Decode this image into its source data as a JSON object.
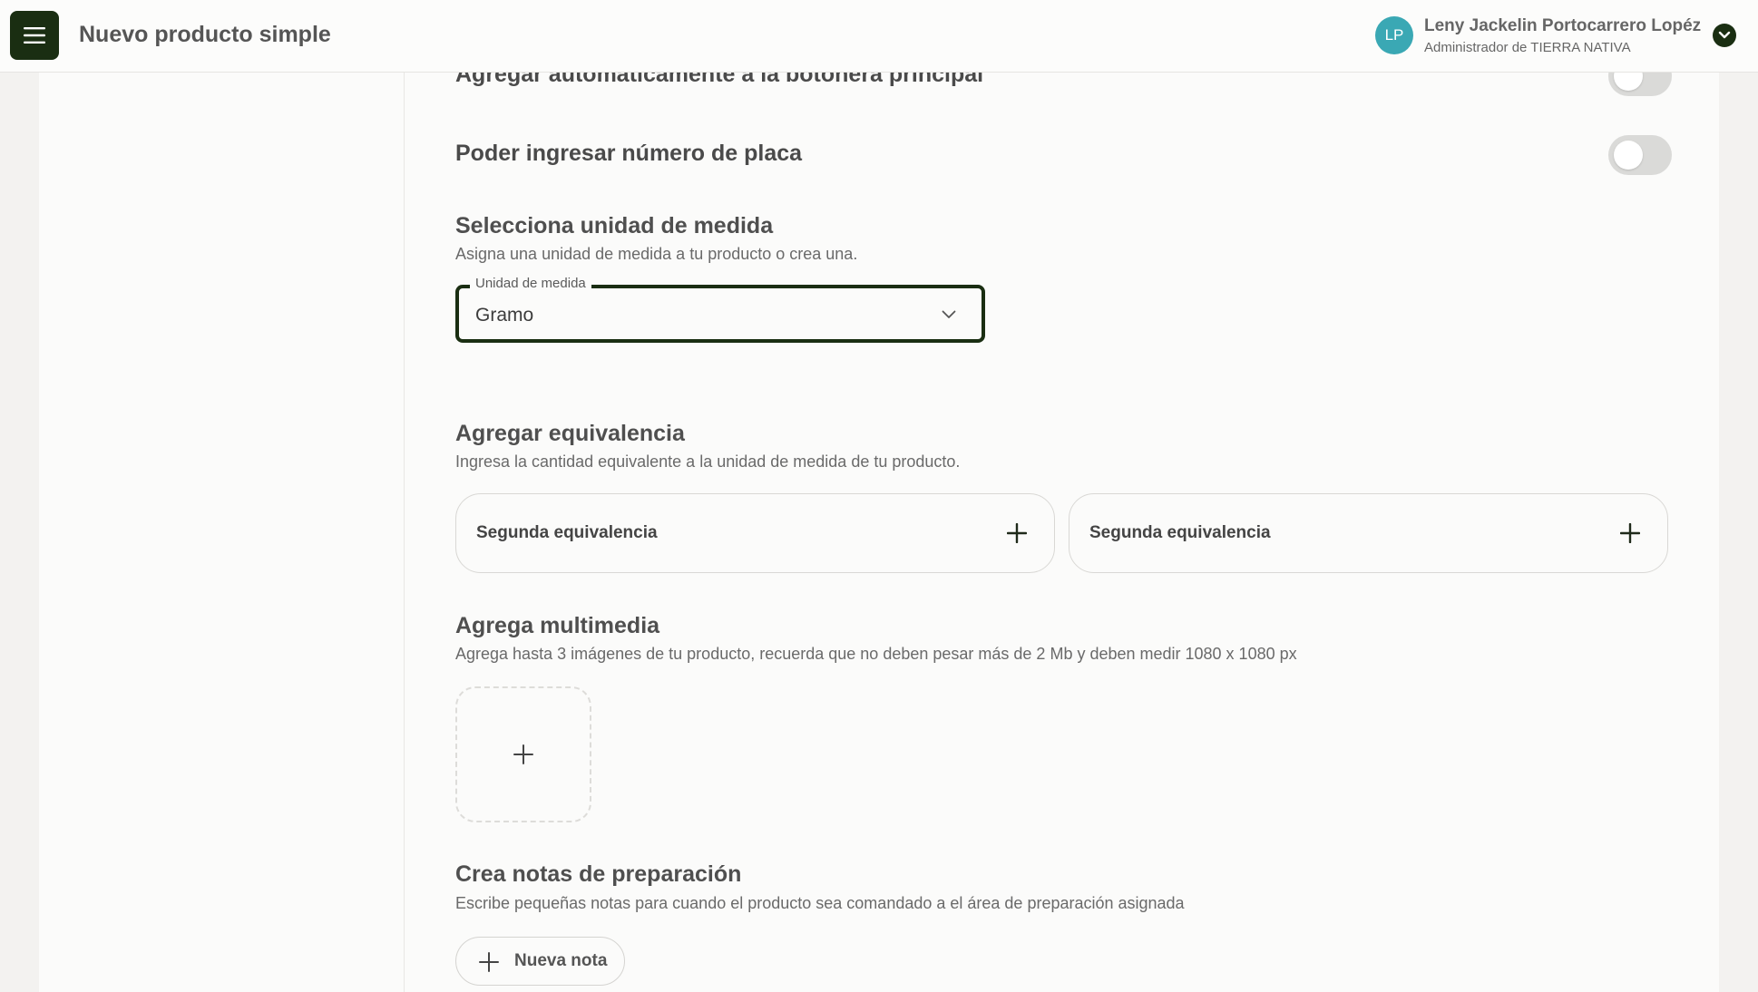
{
  "header": {
    "title": "Nuevo producto simple",
    "user": {
      "initials": "LP",
      "name": "Leny Jackelin Portocarrero Lopéz",
      "role": "Administrador de TIERRA NATIVA"
    }
  },
  "settings": {
    "auto_add_label": "Agregar automáticamente a la botonera principal",
    "plate_number_label": "Poder ingresar número de placa",
    "auto_add_enabled": false,
    "plate_number_enabled": false
  },
  "unit": {
    "title": "Selecciona unidad de medida",
    "subtitle": "Asigna una unidad de medida a tu producto o crea una.",
    "field_label": "Unidad de medida",
    "value": "Gramo"
  },
  "equivalence": {
    "title": "Agregar equivalencia",
    "subtitle": "Ingresa la cantidad equivalente a la unidad de medida de tu producto.",
    "cards": [
      {
        "label": "Segunda equivalencia"
      },
      {
        "label": "Segunda equivalencia"
      }
    ]
  },
  "multimedia": {
    "title": "Agrega multimedia",
    "subtitle": "Agrega hasta 3 imágenes de tu producto, recuerda que no deben pesar más de 2 Mb y deben medir 1080 x 1080 px"
  },
  "notes": {
    "title": "Crea notas de preparación",
    "subtitle": "Escribe pequeñas notas para cuando el producto sea comandado a el área de preparación asignada",
    "new_note_label": "Nueva nota"
  },
  "colors": {
    "primary": "#1a2e12",
    "avatar": "#3aa8b4",
    "toggle_off": "#dadad8"
  },
  "icons": {
    "menu": "menu-icon",
    "user_dropdown": "chevron-down-icon",
    "select": "chevron-down-icon",
    "add": "plus-icon"
  }
}
